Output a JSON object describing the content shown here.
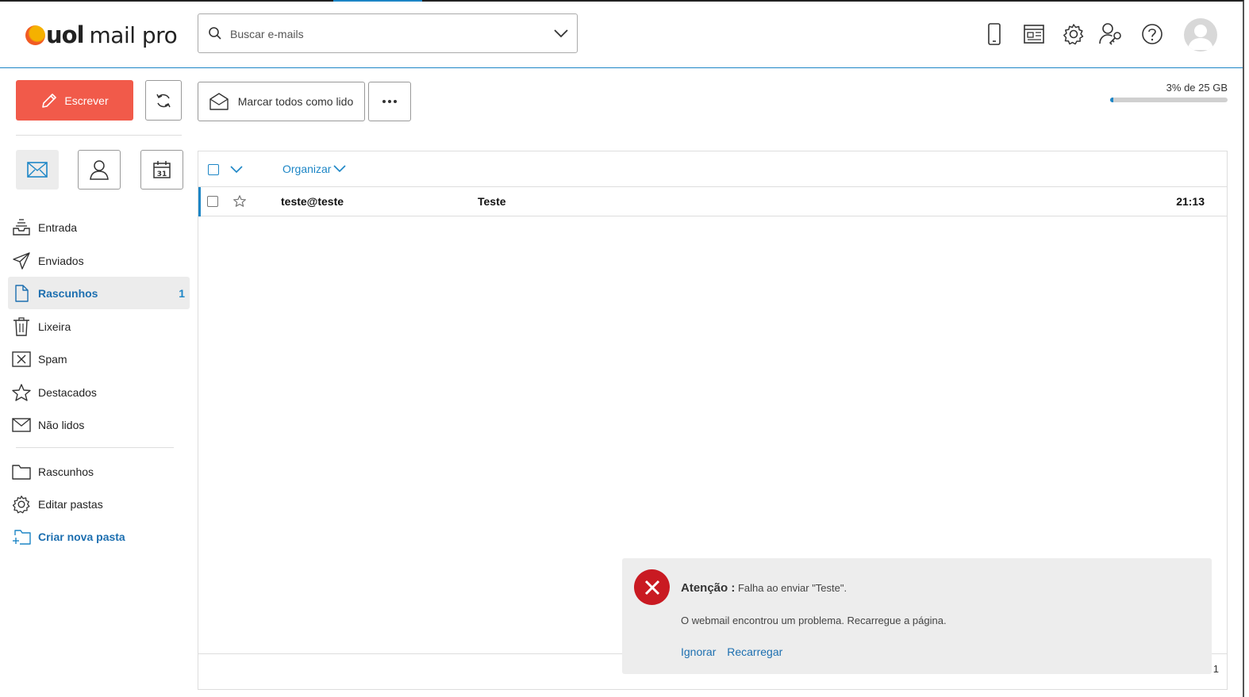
{
  "brand": {
    "name_bold": "uol",
    "name_rest": "mail pro"
  },
  "search": {
    "placeholder": "Buscar e-mails",
    "value": ""
  },
  "header_icons": [
    "mobile-icon",
    "newspaper-icon",
    "gear-icon",
    "admin-key-icon",
    "help-icon"
  ],
  "toolbar": {
    "compose_label": "Escrever",
    "mark_all_label": "Marcar todos como lido",
    "more_label": "···"
  },
  "storage": {
    "text": "3% de 25 GB",
    "fraction": 0.03
  },
  "folders": [
    {
      "label": "Entrada",
      "icon": "inbox-icon"
    },
    {
      "label": "Enviados",
      "icon": "send-icon"
    },
    {
      "label": "Rascunhos",
      "icon": "draft-icon",
      "count": "1",
      "active": true
    },
    {
      "label": "Lixeira",
      "icon": "trash-icon"
    },
    {
      "label": "Spam",
      "icon": "spam-icon"
    },
    {
      "label": "Destacados",
      "icon": "star-icon"
    },
    {
      "label": "Não lidos",
      "icon": "envelope-icon"
    }
  ],
  "custom_folders": [
    {
      "label": "Rascunhos",
      "icon": "folder-icon"
    },
    {
      "label": "Editar pastas",
      "icon": "gear-icon"
    },
    {
      "label": "Criar nova pasta",
      "icon": "folder-add-icon"
    }
  ],
  "list": {
    "organize_label": "Organizar",
    "emails": [
      {
        "from": "teste@teste",
        "subject": "Teste",
        "time": "21:13"
      }
    ],
    "pager": "1"
  },
  "toast": {
    "title": "Atenção :",
    "message": "Falha ao enviar \"Teste\".",
    "detail": "O webmail encontrou um problema. Recarregue a página.",
    "ignore_label": "Ignorar",
    "reload_label": "Recarregar"
  },
  "colors": {
    "accent": "#1d86c6",
    "compose": "#f15a4a",
    "error": "#c91a22"
  }
}
